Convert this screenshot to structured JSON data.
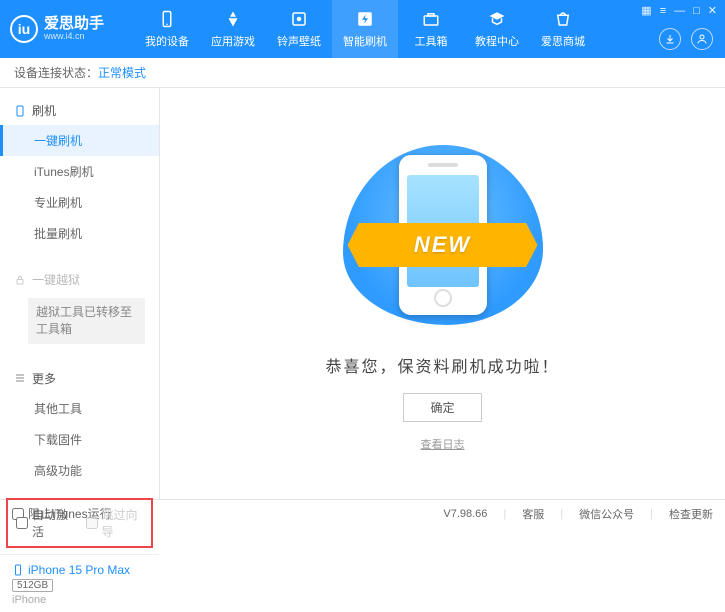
{
  "app": {
    "name_cn": "爱思助手",
    "name_en": "www.i4.cn",
    "logo_letter": "iu"
  },
  "window_controls": {
    "grid": "▦",
    "menu": "≡",
    "min": "—",
    "max": "□",
    "close": "✕"
  },
  "topnav": [
    {
      "id": "device",
      "label": "我的设备"
    },
    {
      "id": "apps",
      "label": "应用游戏"
    },
    {
      "id": "ringtone",
      "label": "铃声壁纸"
    },
    {
      "id": "flash",
      "label": "智能刷机",
      "active": true
    },
    {
      "id": "toolbox",
      "label": "工具箱"
    },
    {
      "id": "tutorials",
      "label": "教程中心"
    },
    {
      "id": "store",
      "label": "爱思商城"
    }
  ],
  "status": {
    "prefix": "设备连接状态：",
    "mode": "正常模式"
  },
  "sidebar": {
    "flash_head": "刷机",
    "flash_items": [
      {
        "label": "一键刷机",
        "active": true
      },
      {
        "label": "iTunes刷机"
      },
      {
        "label": "专业刷机"
      },
      {
        "label": "批量刷机"
      }
    ],
    "jailbreak_head": "一键越狱",
    "jailbreak_note": "越狱工具已转移至工具箱",
    "more_head": "更多",
    "more_items": [
      {
        "label": "其他工具"
      },
      {
        "label": "下载固件"
      },
      {
        "label": "高级功能"
      }
    ],
    "auto_activate": "自动激活",
    "skip_wizard": "跳过向导",
    "device": {
      "name": "iPhone 15 Pro Max",
      "storage": "512GB",
      "type": "iPhone"
    }
  },
  "main": {
    "ribbon": "NEW",
    "success": "恭喜您，保资料刷机成功啦！",
    "ok": "确定",
    "log": "查看日志"
  },
  "footer": {
    "block_itunes": "阻止iTunes运行",
    "version": "V7.98.66",
    "support": "客服",
    "wechat": "微信公众号",
    "update": "检查更新"
  }
}
